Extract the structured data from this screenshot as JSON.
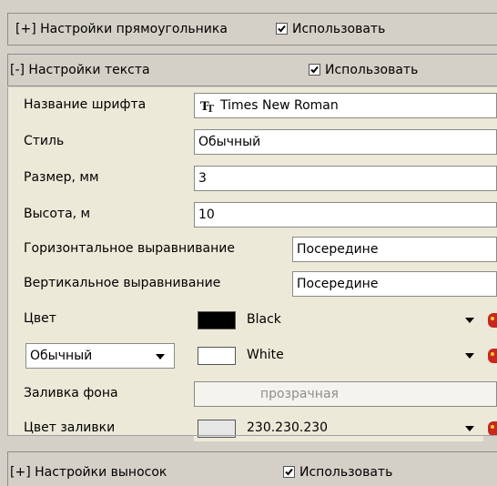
{
  "rect_section": {
    "label": "[+] Настройки прямоугольника",
    "use_label": "Использовать",
    "checked": true
  },
  "text_section": {
    "label": "[-] Настройки текста",
    "use_label": "Использовать",
    "checked": true,
    "rows": {
      "font_name": {
        "label": "Название шрифта",
        "value": "Times New Roman",
        "icon": "truetype-font-icon"
      },
      "style": {
        "label": "Стиль",
        "value": "Обычный"
      },
      "size": {
        "label": "Размер, мм",
        "value": "3"
      },
      "height": {
        "label": "Высота, м",
        "value": "10"
      },
      "h_align": {
        "label": "Горизонтальное выравнивание",
        "value": "Посередине"
      },
      "v_align": {
        "label": "Вертикальное выравнивание",
        "value": "Посередине"
      },
      "color": {
        "label": "Цвет",
        "value": "Black",
        "swatch": "#000000"
      },
      "outline": {
        "mode": "Обычный",
        "value": "White",
        "swatch": "#ffffff"
      },
      "bg_fill": {
        "label": "Заливка фона",
        "value": "прозрачная"
      },
      "fill_color": {
        "label": "Цвет заливки",
        "value": "230.230.230",
        "swatch": "#e6e6e6"
      }
    }
  },
  "callout_section": {
    "label": "[+] Настройки выносок",
    "use_label": "Использовать",
    "checked": true
  }
}
